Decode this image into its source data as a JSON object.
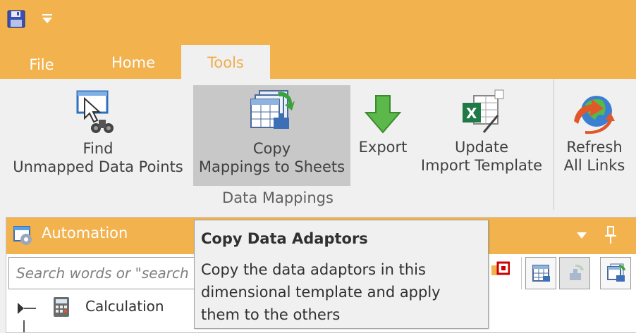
{
  "quick_access": {
    "save_icon": "floppy-disk-icon",
    "customize_icon": "dropdown-arrow-icon"
  },
  "tabs": [
    {
      "label": "File"
    },
    {
      "label": "Home"
    },
    {
      "label": "Tools",
      "active": true
    }
  ],
  "ribbon": {
    "buttons": [
      {
        "line1": "Find",
        "line2": "Unmapped Data Points",
        "icon": "find-unmapped-icon"
      },
      {
        "line1": "Copy",
        "line2": "Mappings to Sheets",
        "icon": "copy-mappings-icon",
        "hovered": true
      },
      {
        "line1": "Export",
        "line2": "",
        "icon": "export-arrow-icon"
      },
      {
        "line1": "Update",
        "line2": "Import Template",
        "icon": "excel-template-icon"
      },
      {
        "line1": "Refresh",
        "line2": "All Links",
        "icon": "refresh-links-icon"
      }
    ],
    "group_label": "Data Mappings"
  },
  "panel": {
    "title": "Automation",
    "search_placeholder": "Search words or \"search t",
    "tree": [
      {
        "label": "Calculation"
      }
    ]
  },
  "tooltip": {
    "title": "Copy Data Adaptors",
    "body": "Copy the data adaptors in this dimensional template and apply them to the others"
  },
  "colors": {
    "accent": "#f2b24e",
    "ribbon_bg": "#f0f0f0",
    "hover_bg": "#c8c8c8"
  }
}
